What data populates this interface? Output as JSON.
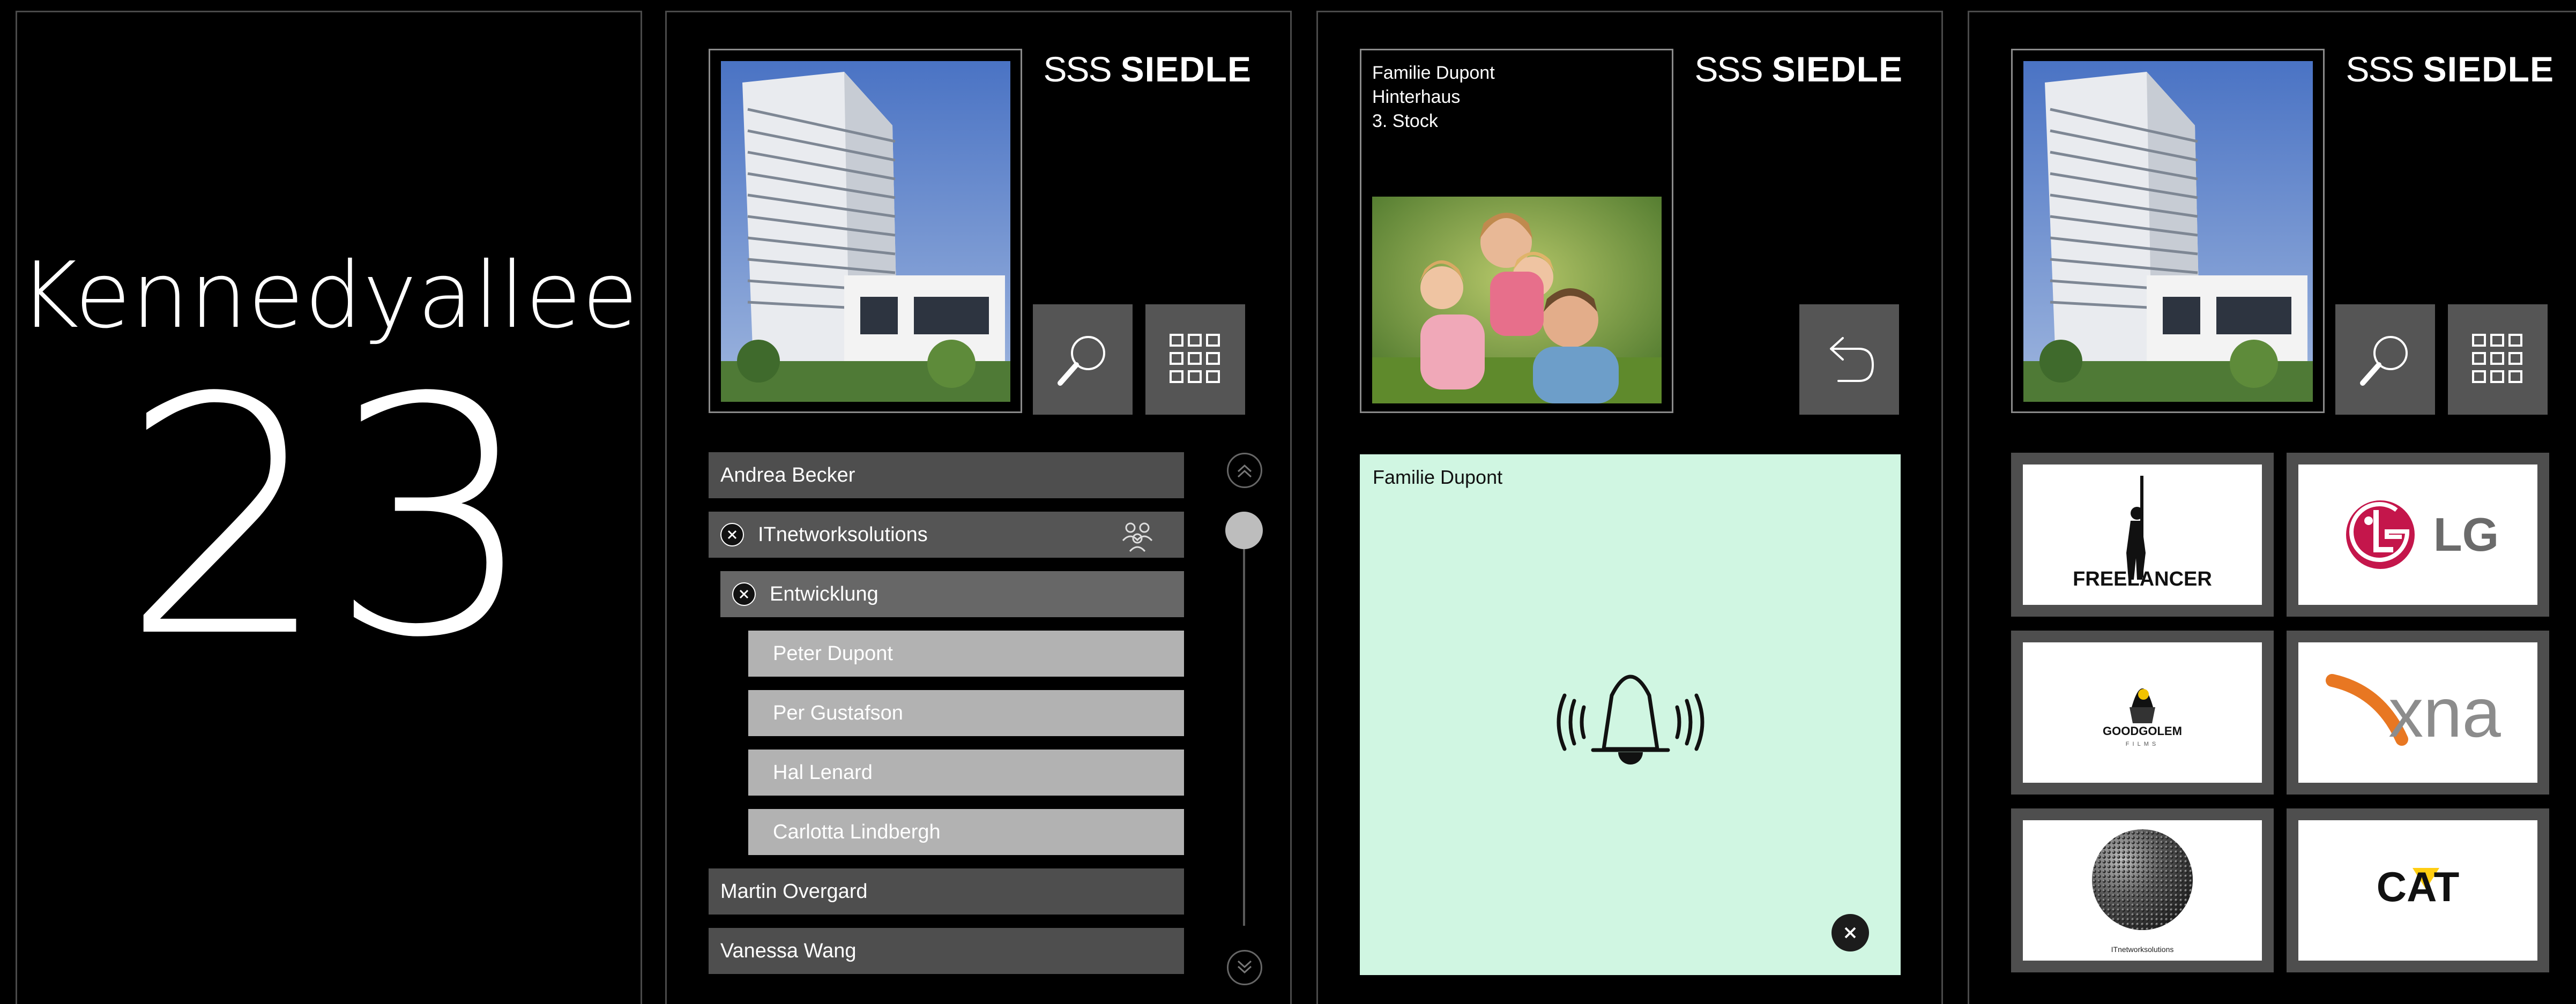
{
  "brand": {
    "sss": "SSS",
    "name": "SIEDLE"
  },
  "address": {
    "street": "Kennedyallee",
    "number": "23"
  },
  "directory": {
    "items": [
      {
        "label": "Andrea Becker",
        "level": 0
      },
      {
        "label": "ITnetworksolutions",
        "level": 1,
        "expanded": true,
        "icon": "group-icon"
      },
      {
        "label": "Entwicklung",
        "level": 1,
        "expanded": true
      },
      {
        "label": "Peter Dupont",
        "level": 2
      },
      {
        "label": "Per Gustafson",
        "level": 2
      },
      {
        "label": "Hal Lenard",
        "level": 2
      },
      {
        "label": "Carlotta Lindbergh",
        "level": 2
      },
      {
        "label": "Martin Overgard",
        "level": 0
      },
      {
        "label": "Vanessa Wang",
        "level": 0
      }
    ]
  },
  "buttons": {
    "search": "search-icon",
    "keypad": "keypad-icon",
    "back": "back-icon"
  },
  "resident": {
    "line1": "Familie Dupont",
    "line2": "Hinterhaus",
    "line3": "3. Stock"
  },
  "call": {
    "label": "Familie Dupont",
    "icon": "bell-icon",
    "close_icon": "close-icon"
  },
  "logos": {
    "freelancer": "FREELANCER",
    "lg": "LG",
    "goodgolem": "GOODGOLEM",
    "goodgolem_sub": "FILMS",
    "xna": "xna",
    "itnetworksolutions": "ITnetworksolutions",
    "cat": "CAT"
  },
  "colors": {
    "call_bg": "#d0f6e2",
    "lg_red": "#c4164b",
    "xna_orange": "#e87722",
    "xna_gray": "#8c8c8c",
    "cat_yellow": "#ffcd11"
  }
}
